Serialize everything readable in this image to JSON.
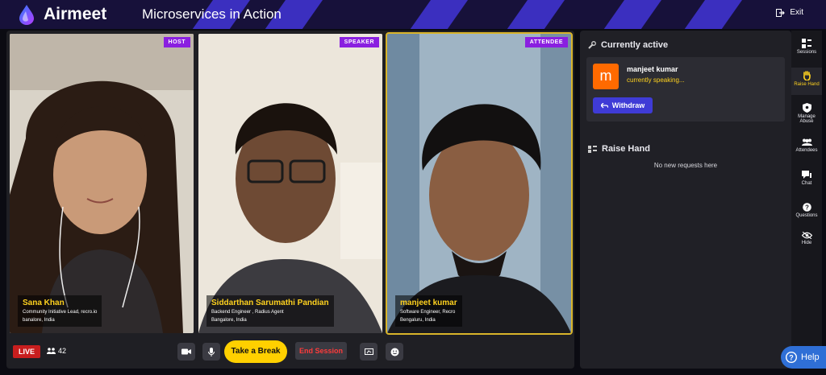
{
  "app": {
    "name": "Airmeet",
    "event_title": "Microservices in Action",
    "exit_label": "Exit",
    "brand_color": "#17113a",
    "accent": "#8a1fe0"
  },
  "tiles": [
    {
      "role": "HOST",
      "name": "Sana Khan",
      "subtitle": "Community Initiative Lead, recro.io",
      "location": "banalore, India"
    },
    {
      "role": "SPEAKER",
      "name": "Siddarthan Sarumathi Pandian",
      "subtitle": "Backend Engineer , Radius Agent",
      "location": "Bangalore, India"
    },
    {
      "role": "ATTENDEE",
      "name": "manjeet kumar",
      "subtitle": "Software Engineer, Recro",
      "location": "Bengaluru, India"
    }
  ],
  "controls": {
    "live_label": "LIVE",
    "attendee_count": "42",
    "take_break_label": "Take a Break",
    "end_session_label": "End Session"
  },
  "panel": {
    "currently_active_title": "Currently active",
    "active_initial": "m",
    "active_name": "manjeet kumar",
    "active_status": "currently speaking...",
    "withdraw_label": "Withdraw",
    "raise_hand_title": "Raise Hand",
    "empty_text": "No new requests here"
  },
  "sidenav": {
    "items": [
      {
        "label": "Sessions",
        "icon": "sessions-icon"
      },
      {
        "label": "Raise Hand",
        "icon": "hand-icon"
      },
      {
        "label": "Manage Abuse",
        "icon": "shield-icon"
      },
      {
        "label": "Attendees",
        "icon": "people-icon"
      },
      {
        "label": "Chat",
        "icon": "chat-icon"
      },
      {
        "label": "Questions",
        "icon": "question-icon"
      },
      {
        "label": "Hide",
        "icon": "eye-icon"
      }
    ]
  },
  "help_label": "Help"
}
